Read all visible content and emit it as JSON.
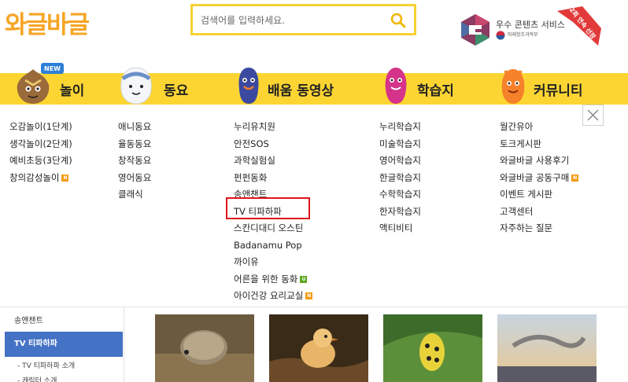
{
  "logo": {
    "text": "와글바글"
  },
  "search": {
    "placeholder": "검색어를 입력하세요."
  },
  "award": {
    "title": "우수 콘텐츠 서비스",
    "ministry": "미래창조과학부",
    "ribbon": "2회 연속 선정"
  },
  "nav": {
    "new_badge": "NEW",
    "items": [
      {
        "label": "놀이"
      },
      {
        "label": "동요"
      },
      {
        "label": "배움 동영상"
      },
      {
        "label": "학습지"
      },
      {
        "label": "커뮤니티"
      }
    ]
  },
  "menu": {
    "col1": [
      "오감놀이(1단계)",
      "생각놀이(2단계)",
      "예비초등(3단계)",
      "창의감성놀이"
    ],
    "col2": [
      "애니동요",
      "율동동요",
      "창작동요",
      "영어동요",
      "클래식"
    ],
    "col3": [
      "누리유치원",
      "안전SOS",
      "과학실험실",
      "펀펀동화",
      "송앤챈트",
      "TV 티파하파",
      "스칸디대디 오스틴",
      "Badanamu Pop",
      "까이유",
      "어른을 위한 동화",
      "아이건강 요리교실"
    ],
    "col4": [
      "누리학습지",
      "미술학습지",
      "영어학습지",
      "한글학습지",
      "수학학습지",
      "한자학습지",
      "액티비티"
    ],
    "col5": [
      "월간유아",
      "토크게시판",
      "와글바글 사용후기",
      "와글바글 공동구매",
      "이벤트 게시판",
      "고객센터",
      "자주하는 질문"
    ],
    "badge_n": "N",
    "badge_u": "U"
  },
  "sidebar": {
    "item_songchant": "송앤챈트",
    "item_active": "TV 티파하파",
    "sub1": "- TV 티파하파 소개",
    "sub2": "- 캐릭터 소개"
  },
  "colors": {
    "nav_yellow": "#fcd533",
    "search_border": "#f6d233",
    "active_blue": "#4472c4",
    "highlight_red": "#e0141a"
  }
}
